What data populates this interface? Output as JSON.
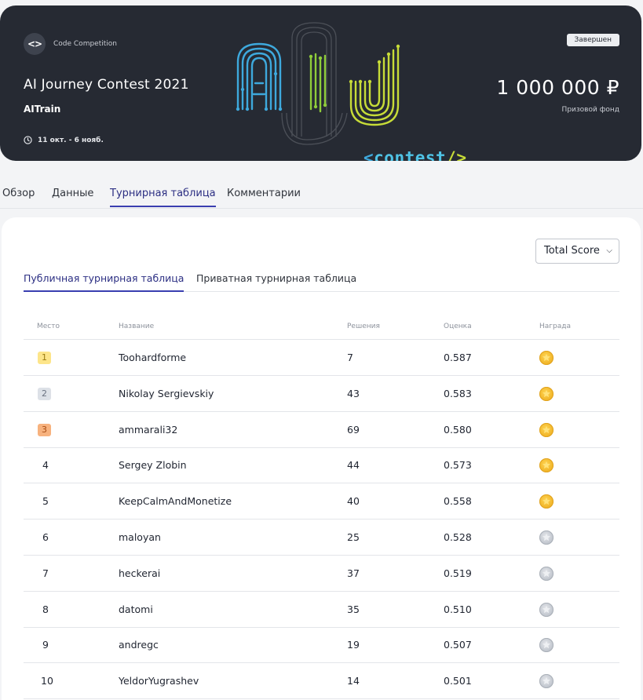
{
  "banner": {
    "type_label": "Code Competition",
    "title": "AI Journey Contest 2021",
    "organizer": "AITrain",
    "dates": "11 окт. - 6 нояб.",
    "status": "Завершен",
    "prize_amount": "1 000 000 ₽",
    "prize_label": "Призовой фонд",
    "logo_text": {
      "lt": "<",
      "word": "contest",
      "slash": "/",
      "gt": ">"
    }
  },
  "tabs": [
    "Обзор",
    "Данные",
    "Турнирная таблица",
    "Комментарии"
  ],
  "score_select": {
    "value": "Total Score"
  },
  "subtabs": [
    "Публичная турнирная таблица",
    "Приватная турнирная таблица"
  ],
  "table": {
    "headers": [
      "Место",
      "Название",
      "Решения",
      "Оценка",
      "Награда"
    ],
    "rows": [
      {
        "rank": "1",
        "name": "Toohardforme",
        "submissions": "7",
        "score": "0.587",
        "award": "gold"
      },
      {
        "rank": "2",
        "name": "Nikolay Sergievskiy",
        "submissions": "43",
        "score": "0.583",
        "award": "gold"
      },
      {
        "rank": "3",
        "name": "ammarali32",
        "submissions": "69",
        "score": "0.580",
        "award": "gold"
      },
      {
        "rank": "4",
        "name": "Sergey Zlobin",
        "submissions": "44",
        "score": "0.573",
        "award": "gold"
      },
      {
        "rank": "5",
        "name": "KeepCalmAndMonetize",
        "submissions": "40",
        "score": "0.558",
        "award": "gold"
      },
      {
        "rank": "6",
        "name": "maloyan",
        "submissions": "25",
        "score": "0.528",
        "award": "silver"
      },
      {
        "rank": "7",
        "name": "heckerai",
        "submissions": "37",
        "score": "0.519",
        "award": "silver"
      },
      {
        "rank": "8",
        "name": "datomi",
        "submissions": "35",
        "score": "0.510",
        "award": "silver"
      },
      {
        "rank": "9",
        "name": "andregc",
        "submissions": "19",
        "score": "0.507",
        "award": "silver"
      },
      {
        "rank": "10",
        "name": "YeldorYugrashev",
        "submissions": "14",
        "score": "0.501",
        "award": "silver"
      }
    ]
  },
  "colors": {
    "banner_bg": "#262a33",
    "accent": "#3a3fb0",
    "rank1_badge": "#fde58a",
    "rank2_badge": "#dde1e7",
    "rank3_badge": "#f7b27e",
    "medal_gold": "#f1b52a",
    "medal_silver": "#c1c6ce"
  }
}
